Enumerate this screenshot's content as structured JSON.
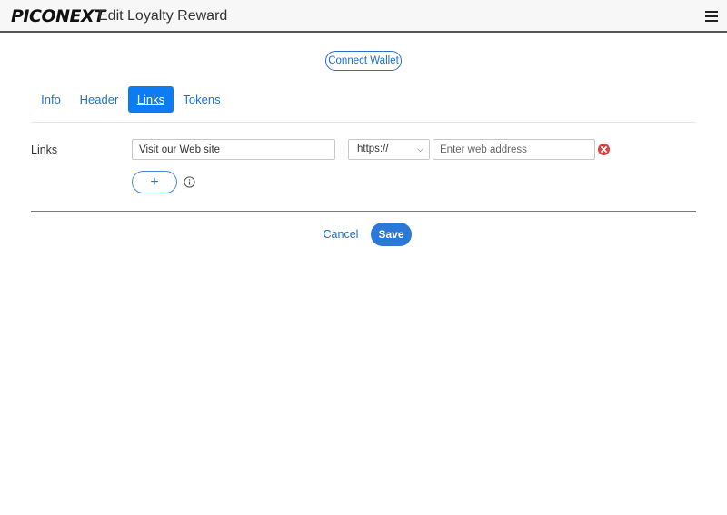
{
  "header": {
    "logo_text": "PICONEXT",
    "title": "Edit Loyalty Reward",
    "menu_icon": "hamburger-menu-icon"
  },
  "wallet": {
    "connect_label": "Connect Wallet"
  },
  "tabs": [
    {
      "label": "Info",
      "active": false
    },
    {
      "label": "Header",
      "active": false
    },
    {
      "label": "Links",
      "active": true
    },
    {
      "label": "Tokens",
      "active": false
    }
  ],
  "links_section": {
    "label": "Links",
    "rows": [
      {
        "text_value": "Visit our Web site",
        "protocol": "https://",
        "address_value": "",
        "address_placeholder": "Enter web address",
        "remove_icon": "close-circle-icon"
      }
    ],
    "add_label": "+",
    "info_icon": "info-circle-icon"
  },
  "actions": {
    "cancel_label": "Cancel",
    "save_label": "Save"
  },
  "colors": {
    "accent": "#0d7cf2",
    "save": "#2b78d6",
    "danger": "#d64545",
    "link": "#1a73d9"
  }
}
